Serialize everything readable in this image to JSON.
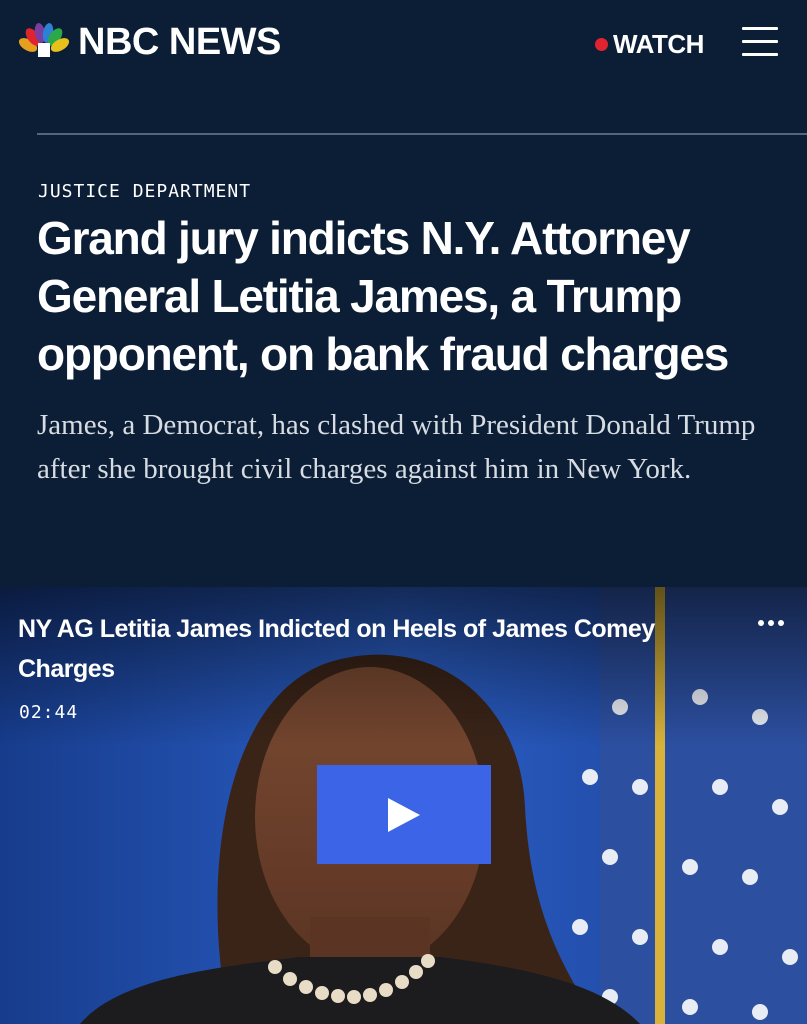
{
  "header": {
    "logo_text": "NBC NEWS",
    "logo_icon": "nbc-peacock-icon",
    "watch_label": "WATCH",
    "watch_dot_color": "#e0242f",
    "menu_icon": "hamburger-menu-icon"
  },
  "article": {
    "section": "JUSTICE DEPARTMENT",
    "headline": "Grand jury indicts N.Y. Attorney General Letitia James, a Trump opponent, on bank fraud charges",
    "dek": "James, a Democrat, has clashed with President Donald Trump after she brought civil charges against him in New York."
  },
  "video": {
    "title": "NY AG Letitia James Indicted on Heels of James Comey Charges",
    "duration": "02:44",
    "more_icon": "more-options-icon",
    "play_icon": "play-icon",
    "play_button_color": "#3b64e6"
  },
  "colors": {
    "background": "#0c1e36",
    "accent": "#3b64e6",
    "live_red": "#e0242f"
  }
}
